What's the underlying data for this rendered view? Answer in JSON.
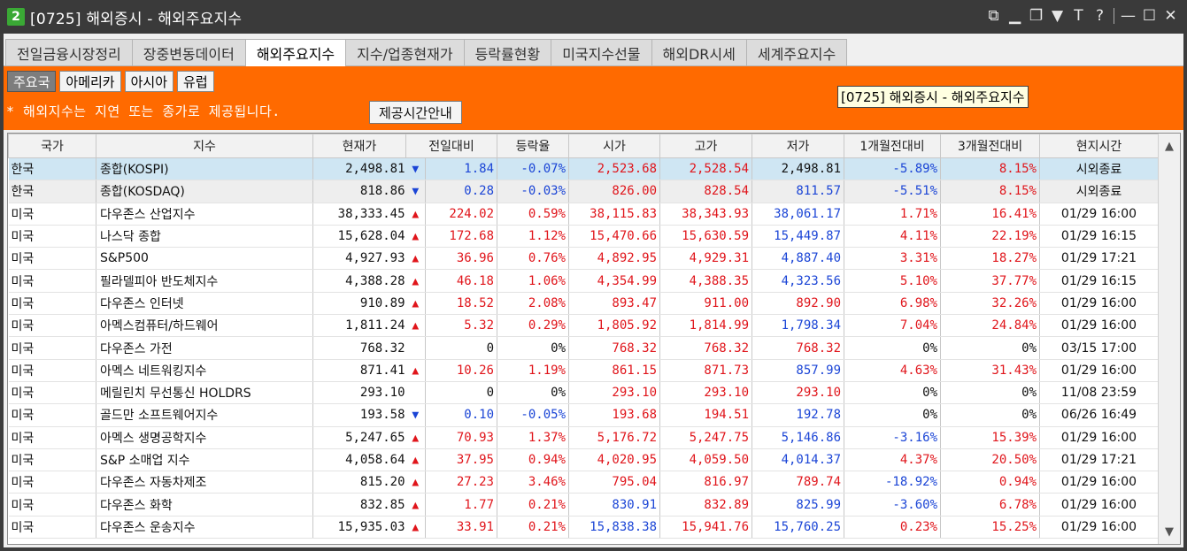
{
  "window": {
    "badge": "2",
    "title": "[0725] 해외증시 - 해외주요지수",
    "controls": [
      "link-icon",
      "minimize-to-tray-icon",
      "restore-icon",
      "pin-icon",
      "font-icon",
      "help-icon",
      "minimize-icon",
      "maximize-icon",
      "close-icon"
    ],
    "control_glyphs": [
      "⧉",
      "▁",
      "❐",
      "▼",
      "T",
      "?",
      "—",
      "☐",
      "✕"
    ]
  },
  "tabs": [
    "전일금융시장정리",
    "장중변동데이터",
    "해외주요지수",
    "지수/업종현재가",
    "등락률현황",
    "미국지수선물",
    "해외DR시세",
    "세계주요지수"
  ],
  "active_tab": "해외주요지수",
  "subtabs": [
    "주요국",
    "아메리카",
    "아시아",
    "유럽"
  ],
  "active_subtab": "주요국",
  "notice": "* 해외지수는 지연 또는 종가로 제공됩니다.",
  "info_button": "제공시간안내",
  "tooltip": "[0725] 해외증시 - 해외주요지수",
  "colors": {
    "up": "#e0151b",
    "down": "#1b45d6",
    "orange": "#ff6a00",
    "selected": "#cfe6f3"
  },
  "table": {
    "headers": [
      "국가",
      "지수",
      "현재가",
      "전일대비",
      "등락율",
      "시가",
      "고가",
      "저가",
      "1개월전대비",
      "3개월전대비",
      "현지시간"
    ],
    "rows": [
      {
        "country": "한국",
        "index": "종합(KOSPI)",
        "price": "2,498.81",
        "dir": "down",
        "change": "1.84",
        "rate": "-0.07%",
        "open": "2,523.68",
        "high": "2,528.54",
        "low": "2,498.81",
        "m1": "-5.89%",
        "m3": "8.15%",
        "time": "시외종료",
        "oc": "up",
        "hc": "up",
        "lc": "flat",
        "m1c": "down",
        "m3c": "up"
      },
      {
        "country": "한국",
        "index": "종합(KOSDAQ)",
        "price": "818.86",
        "dir": "down",
        "change": "0.28",
        "rate": "-0.03%",
        "open": "826.00",
        "high": "828.54",
        "low": "811.57",
        "m1": "-5.51%",
        "m3": "8.15%",
        "time": "시외종료",
        "oc": "up",
        "hc": "up",
        "lc": "down",
        "m1c": "down",
        "m3c": "up"
      },
      {
        "country": "미국",
        "index": "다우존스 산업지수",
        "price": "38,333.45",
        "dir": "up",
        "change": "224.02",
        "rate": "0.59%",
        "open": "38,115.83",
        "high": "38,343.93",
        "low": "38,061.17",
        "m1": "1.71%",
        "m3": "16.41%",
        "time": "01/29 16:00",
        "oc": "up",
        "hc": "up",
        "lc": "down",
        "m1c": "up",
        "m3c": "up"
      },
      {
        "country": "미국",
        "index": "나스닥 종합",
        "price": "15,628.04",
        "dir": "up",
        "change": "172.68",
        "rate": "1.12%",
        "open": "15,470.66",
        "high": "15,630.59",
        "low": "15,449.87",
        "m1": "4.11%",
        "m3": "22.19%",
        "time": "01/29 16:15",
        "oc": "up",
        "hc": "up",
        "lc": "down",
        "m1c": "up",
        "m3c": "up"
      },
      {
        "country": "미국",
        "index": "S&P500",
        "price": "4,927.93",
        "dir": "up",
        "change": "36.96",
        "rate": "0.76%",
        "open": "4,892.95",
        "high": "4,929.31",
        "low": "4,887.40",
        "m1": "3.31%",
        "m3": "18.27%",
        "time": "01/29 17:21",
        "oc": "up",
        "hc": "up",
        "lc": "down",
        "m1c": "up",
        "m3c": "up"
      },
      {
        "country": "미국",
        "index": "필라델피아 반도체지수",
        "price": "4,388.28",
        "dir": "up",
        "change": "46.18",
        "rate": "1.06%",
        "open": "4,354.99",
        "high": "4,388.35",
        "low": "4,323.56",
        "m1": "5.10%",
        "m3": "37.77%",
        "time": "01/29 16:15",
        "oc": "up",
        "hc": "up",
        "lc": "down",
        "m1c": "up",
        "m3c": "up"
      },
      {
        "country": "미국",
        "index": "다우존스 인터넷",
        "price": "910.89",
        "dir": "up",
        "change": "18.52",
        "rate": "2.08%",
        "open": "893.47",
        "high": "911.00",
        "low": "892.90",
        "m1": "6.98%",
        "m3": "32.26%",
        "time": "01/29 16:00",
        "oc": "up",
        "hc": "up",
        "lc": "up",
        "m1c": "up",
        "m3c": "up"
      },
      {
        "country": "미국",
        "index": "아멕스컴퓨터/하드웨어",
        "price": "1,811.24",
        "dir": "up",
        "change": "5.32",
        "rate": "0.29%",
        "open": "1,805.92",
        "high": "1,814.99",
        "low": "1,798.34",
        "m1": "7.04%",
        "m3": "24.84%",
        "time": "01/29 16:00",
        "oc": "up",
        "hc": "up",
        "lc": "down",
        "m1c": "up",
        "m3c": "up"
      },
      {
        "country": "미국",
        "index": "다우존스 가전",
        "price": "768.32",
        "dir": "flat",
        "change": "0",
        "rate": "0%",
        "open": "768.32",
        "high": "768.32",
        "low": "768.32",
        "m1": "0%",
        "m3": "0%",
        "time": "03/15 17:00",
        "oc": "up",
        "hc": "up",
        "lc": "up",
        "m1c": "flat",
        "m3c": "flat"
      },
      {
        "country": "미국",
        "index": "아멕스 네트워킹지수",
        "price": "871.41",
        "dir": "up",
        "change": "10.26",
        "rate": "1.19%",
        "open": "861.15",
        "high": "871.73",
        "low": "857.99",
        "m1": "4.63%",
        "m3": "31.43%",
        "time": "01/29 16:00",
        "oc": "up",
        "hc": "up",
        "lc": "down",
        "m1c": "up",
        "m3c": "up"
      },
      {
        "country": "미국",
        "index": "메릴린치 무선통신 HOLDRS",
        "price": "293.10",
        "dir": "flat",
        "change": "0",
        "rate": "0%",
        "open": "293.10",
        "high": "293.10",
        "low": "293.10",
        "m1": "0%",
        "m3": "0%",
        "time": "11/08 23:59",
        "oc": "up",
        "hc": "up",
        "lc": "up",
        "m1c": "flat",
        "m3c": "flat"
      },
      {
        "country": "미국",
        "index": "골드만 소프트웨어지수",
        "price": "193.58",
        "dir": "down",
        "change": "0.10",
        "rate": "-0.05%",
        "open": "193.68",
        "high": "194.51",
        "low": "192.78",
        "m1": "0%",
        "m3": "0%",
        "time": "06/26 16:49",
        "oc": "up",
        "hc": "up",
        "lc": "down",
        "m1c": "flat",
        "m3c": "flat"
      },
      {
        "country": "미국",
        "index": "아멕스 생명공학지수",
        "price": "5,247.65",
        "dir": "up",
        "change": "70.93",
        "rate": "1.37%",
        "open": "5,176.72",
        "high": "5,247.75",
        "low": "5,146.86",
        "m1": "-3.16%",
        "m3": "15.39%",
        "time": "01/29 16:00",
        "oc": "up",
        "hc": "up",
        "lc": "down",
        "m1c": "down",
        "m3c": "up"
      },
      {
        "country": "미국",
        "index": "S&P 소매업 지수",
        "price": "4,058.64",
        "dir": "up",
        "change": "37.95",
        "rate": "0.94%",
        "open": "4,020.95",
        "high": "4,059.50",
        "low": "4,014.37",
        "m1": "4.37%",
        "m3": "20.50%",
        "time": "01/29 17:21",
        "oc": "up",
        "hc": "up",
        "lc": "down",
        "m1c": "up",
        "m3c": "up"
      },
      {
        "country": "미국",
        "index": "다우존스 자동차제조",
        "price": "815.20",
        "dir": "up",
        "change": "27.23",
        "rate": "3.46%",
        "open": "795.04",
        "high": "816.97",
        "low": "789.74",
        "m1": "-18.92%",
        "m3": "0.94%",
        "time": "01/29 16:00",
        "oc": "up",
        "hc": "up",
        "lc": "up",
        "m1c": "down",
        "m3c": "up"
      },
      {
        "country": "미국",
        "index": "다우존스 화학",
        "price": "832.85",
        "dir": "up",
        "change": "1.77",
        "rate": "0.21%",
        "open": "830.91",
        "high": "832.89",
        "low": "825.99",
        "m1": "-3.60%",
        "m3": "6.78%",
        "time": "01/29 16:00",
        "oc": "down",
        "hc": "up",
        "lc": "down",
        "m1c": "down",
        "m3c": "up"
      },
      {
        "country": "미국",
        "index": "다우존스 운송지수",
        "price": "15,935.03",
        "dir": "up",
        "change": "33.91",
        "rate": "0.21%",
        "open": "15,838.38",
        "high": "15,941.76",
        "low": "15,760.25",
        "m1": "0.23%",
        "m3": "15.25%",
        "time": "01/29 16:00",
        "oc": "down",
        "hc": "up",
        "lc": "down",
        "m1c": "up",
        "m3c": "up"
      }
    ]
  }
}
